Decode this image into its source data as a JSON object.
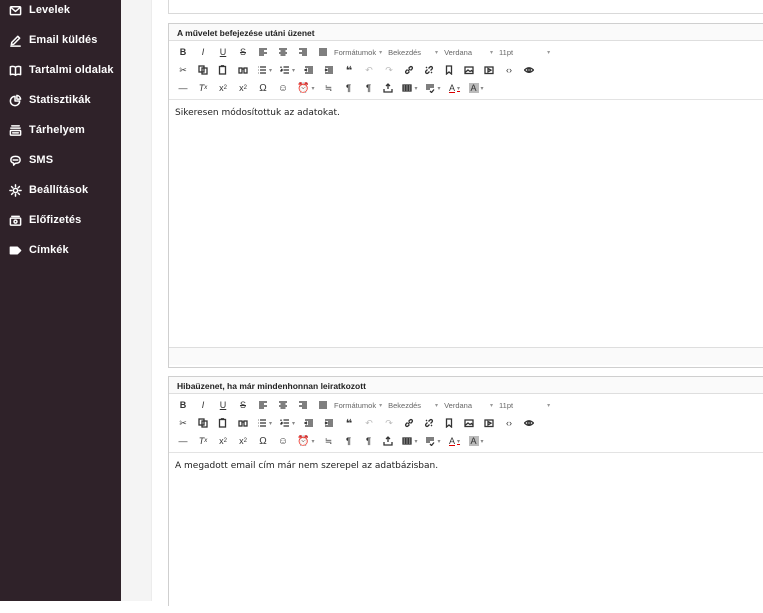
{
  "sidebar": {
    "items": [
      {
        "label": "Levelek",
        "icon": "mail-icon"
      },
      {
        "label": "Email küldés",
        "icon": "pencil-icon"
      },
      {
        "label": "Tartalmi oldalak",
        "icon": "book-icon"
      },
      {
        "label": "Statisztikák",
        "icon": "pie-chart-icon"
      },
      {
        "label": "Tárhelyem",
        "icon": "storage-icon"
      },
      {
        "label": "SMS",
        "icon": "chat-icon"
      },
      {
        "label": "Beállítások",
        "icon": "gear-icon"
      },
      {
        "label": "Előfizetés",
        "icon": "subscription-icon"
      },
      {
        "label": "Címkék",
        "icon": "tag-icon"
      }
    ]
  },
  "toolbar": {
    "formats": "Formátumok",
    "paragraph": "Bekezdés",
    "font": "Verdana",
    "size": "11pt"
  },
  "editors": [
    {
      "title": "A művelet befejezése utáni üzenet",
      "content": "Sikeresen módosítottuk az adatokat."
    },
    {
      "title": "Hibaüzenet, ha már mindenhonnan leiratkozott",
      "content": "A megadott email cím már nem szerepel az adatbázisban."
    }
  ],
  "colors": {
    "sidebar_bg": "#2f2229",
    "sidebar_text": "#ffffff"
  }
}
